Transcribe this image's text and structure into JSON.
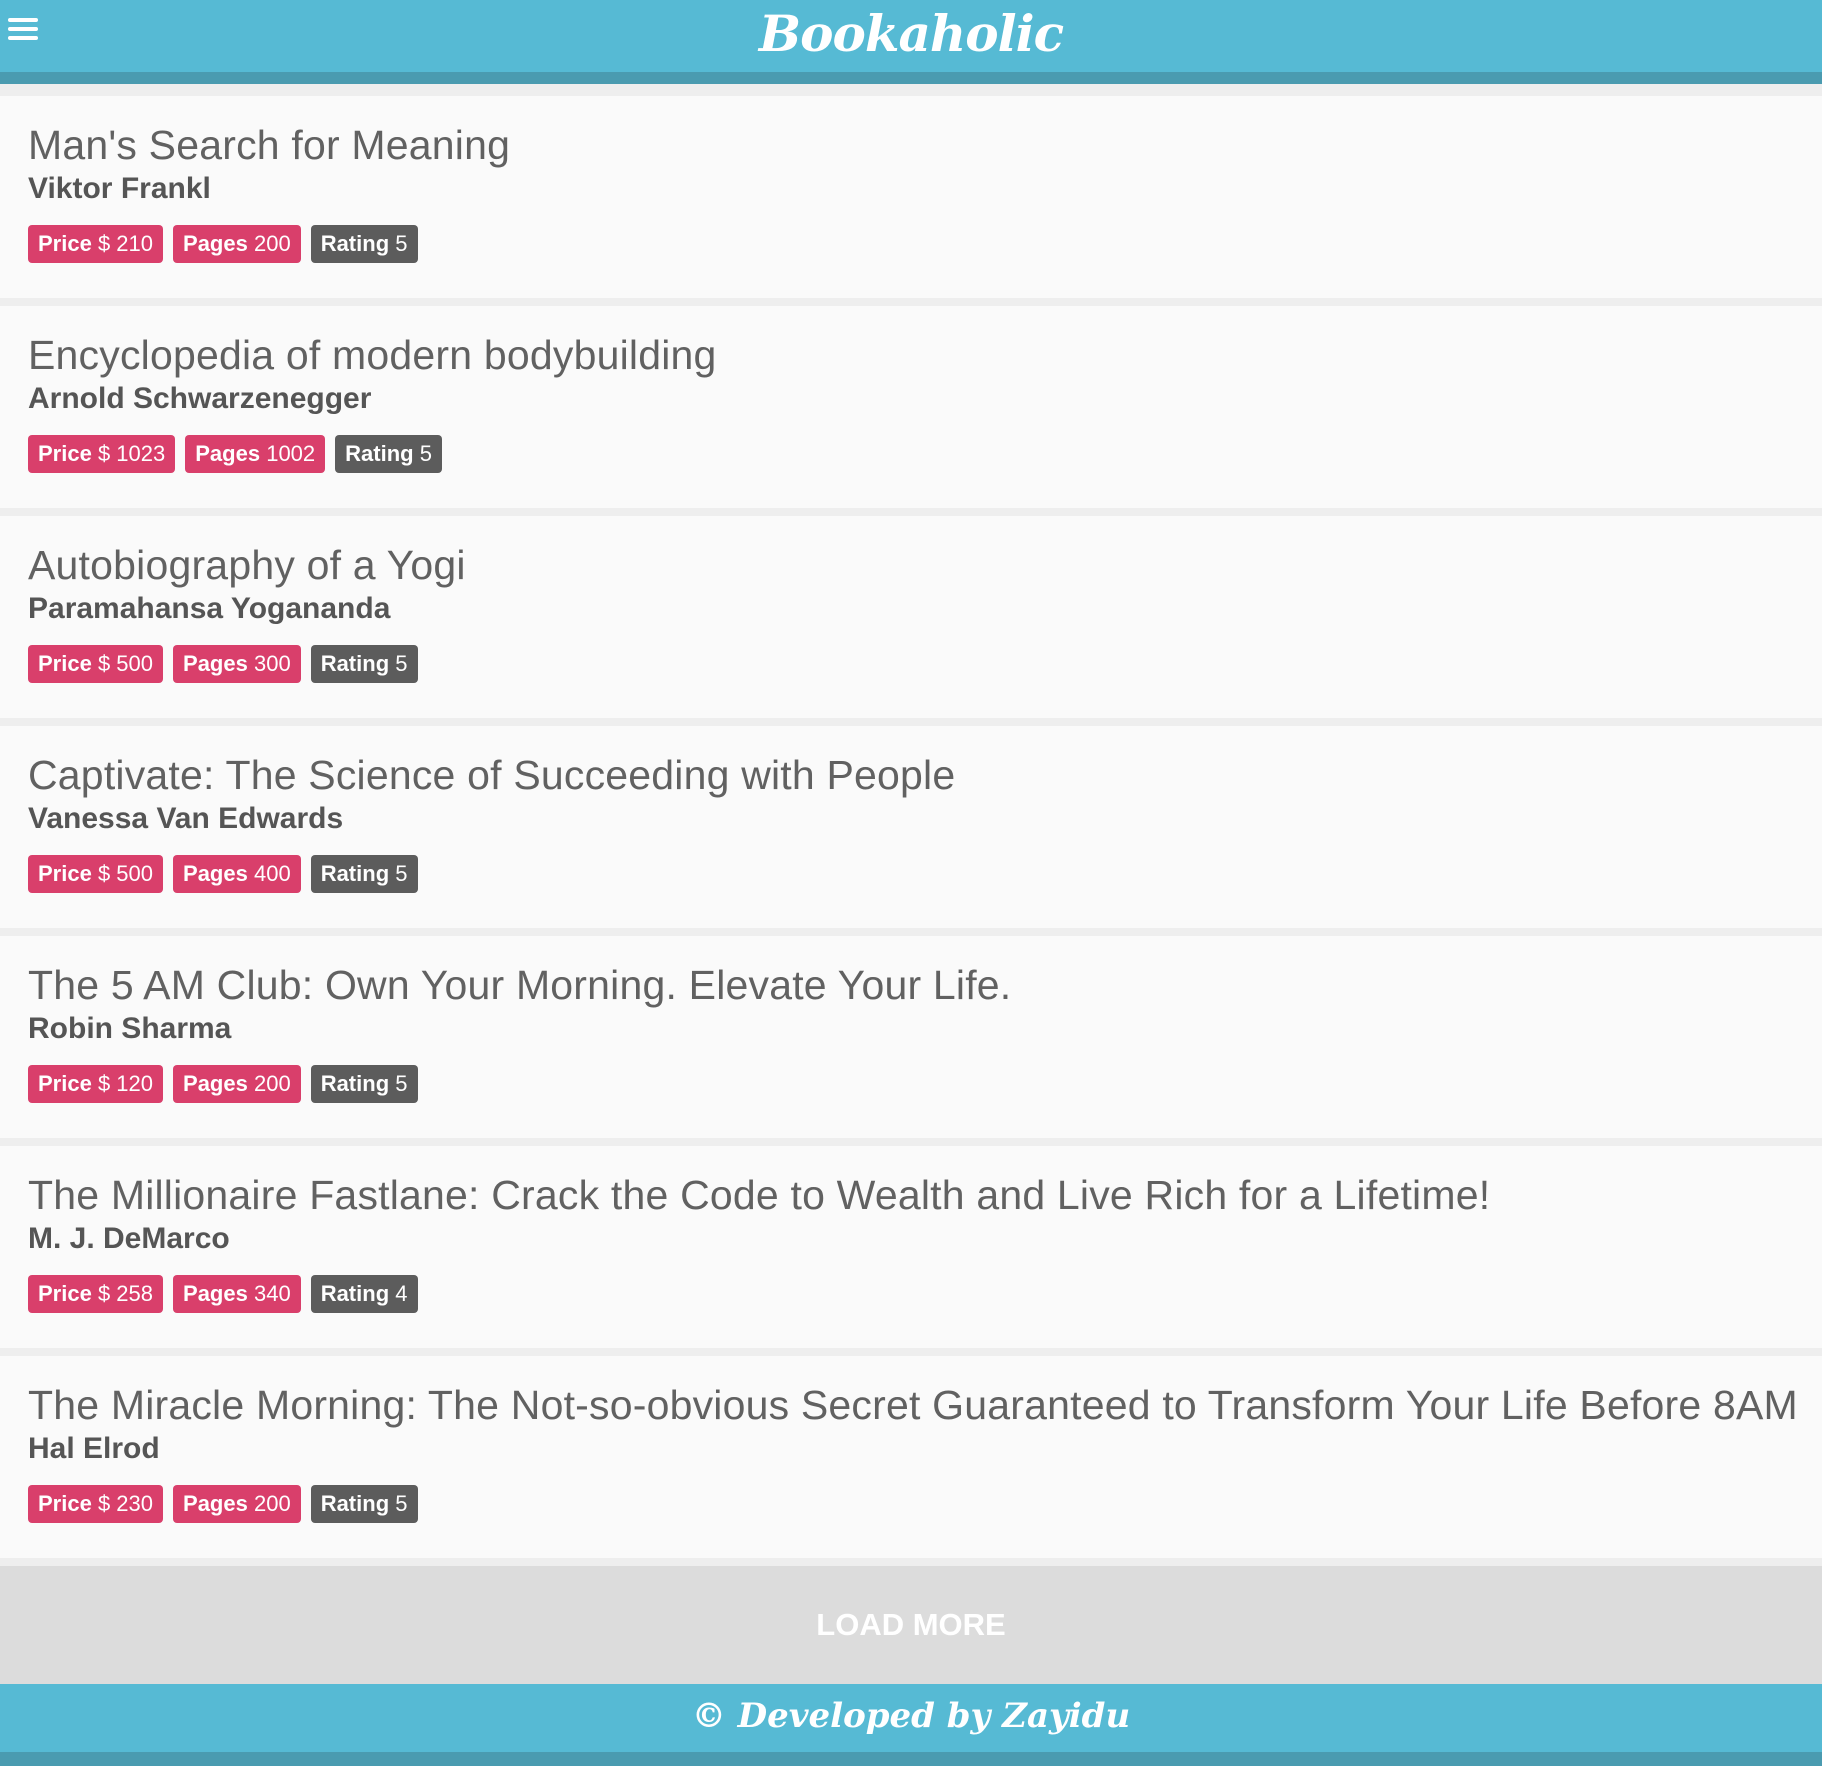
{
  "app": {
    "title": "Bookaholic",
    "menu_icon": "hamburger-menu-icon"
  },
  "books": [
    {
      "title": "Man's Search for Meaning",
      "author": "Viktor Frankl",
      "price_label": "Price",
      "price": "$ 210",
      "pages_label": "Pages",
      "pages": "200",
      "rating_label": "Rating",
      "rating": "5"
    },
    {
      "title": "Encyclopedia of modern bodybuilding",
      "author": "Arnold Schwarzenegger",
      "price_label": "Price",
      "price": "$ 1023",
      "pages_label": "Pages",
      "pages": "1002",
      "rating_label": "Rating",
      "rating": "5"
    },
    {
      "title": "Autobiography of a Yogi",
      "author": "Paramahansa Yogananda",
      "price_label": "Price",
      "price": "$ 500",
      "pages_label": "Pages",
      "pages": "300",
      "rating_label": "Rating",
      "rating": "5"
    },
    {
      "title": "Captivate: The Science of Succeeding with People",
      "author": "Vanessa Van Edwards",
      "price_label": "Price",
      "price": "$ 500",
      "pages_label": "Pages",
      "pages": "400",
      "rating_label": "Rating",
      "rating": "5"
    },
    {
      "title": "The 5 AM Club: Own Your Morning. Elevate Your Life.",
      "author": "Robin Sharma",
      "price_label": "Price",
      "price": "$ 120",
      "pages_label": "Pages",
      "pages": "200",
      "rating_label": "Rating",
      "rating": "5"
    },
    {
      "title": "The Millionaire Fastlane: Crack the Code to Wealth and Live Rich for a Lifetime!",
      "author": "M. J. DeMarco",
      "price_label": "Price",
      "price": "$ 258",
      "pages_label": "Pages",
      "pages": "340",
      "rating_label": "Rating",
      "rating": "4"
    },
    {
      "title": "The Miracle Morning: The Not-so-obvious Secret Guaranteed to Transform Your Life Before 8AM",
      "author": "Hal Elrod",
      "price_label": "Price",
      "price": "$ 230",
      "pages_label": "Pages",
      "pages": "200",
      "rating_label": "Rating",
      "rating": "5"
    }
  ],
  "load_more": {
    "label": "LOAD MORE"
  },
  "footer": {
    "text": "© Developed by Zayidu"
  },
  "colors": {
    "header_bg": "#56bad4",
    "header_border": "#4a9bb0",
    "badge_pink": "#d93f6b",
    "badge_gray": "#5c5c5c",
    "load_more_bg": "#dcdcdc"
  }
}
